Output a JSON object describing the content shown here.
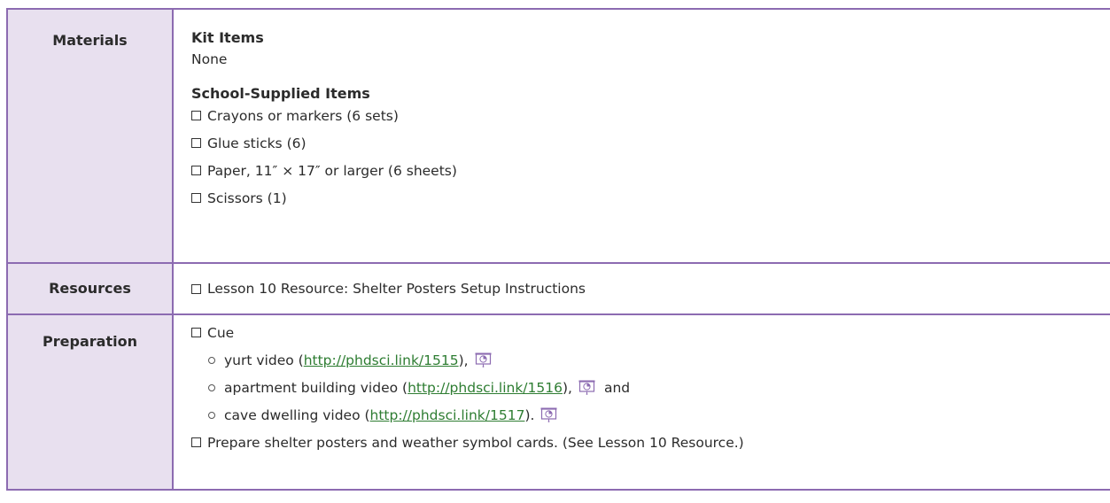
{
  "materials": {
    "header": "Materials",
    "kit_heading": "Kit Items",
    "kit_value": "None",
    "school_heading": "School-Supplied Items",
    "school_items": [
      "Crayons or markers (6 sets)",
      "Glue sticks (6)",
      "Paper, 11″ × 17″ or larger (6 sheets)",
      "Scissors (1)"
    ]
  },
  "resources": {
    "header": "Resources",
    "items": [
      "Lesson 10 Resource: Shelter Posters Setup Instructions"
    ]
  },
  "preparation": {
    "header": "Preparation",
    "cue_label": "Cue",
    "videos": [
      {
        "before": "yurt video (",
        "link": "http://phdsci.link/1515",
        "after": "),",
        "tail": ""
      },
      {
        "before": "apartment building video (",
        "link": "http://phdsci.link/1516",
        "after": "),",
        "tail": "and"
      },
      {
        "before": "cave dwelling video (",
        "link": "http://phdsci.link/1517",
        "after": ").",
        "tail": ""
      }
    ],
    "final_item": "Prepare shelter posters and weather symbol cards. (See Lesson 10 Resource.)"
  },
  "colors": {
    "border": "#8c6bb1",
    "header_bg": "#e8e0ef",
    "link": "#2e7d32"
  },
  "icons": {
    "checkbox": "checkbox-icon",
    "video": "video-timer-icon",
    "bullet": "bullet-icon"
  }
}
